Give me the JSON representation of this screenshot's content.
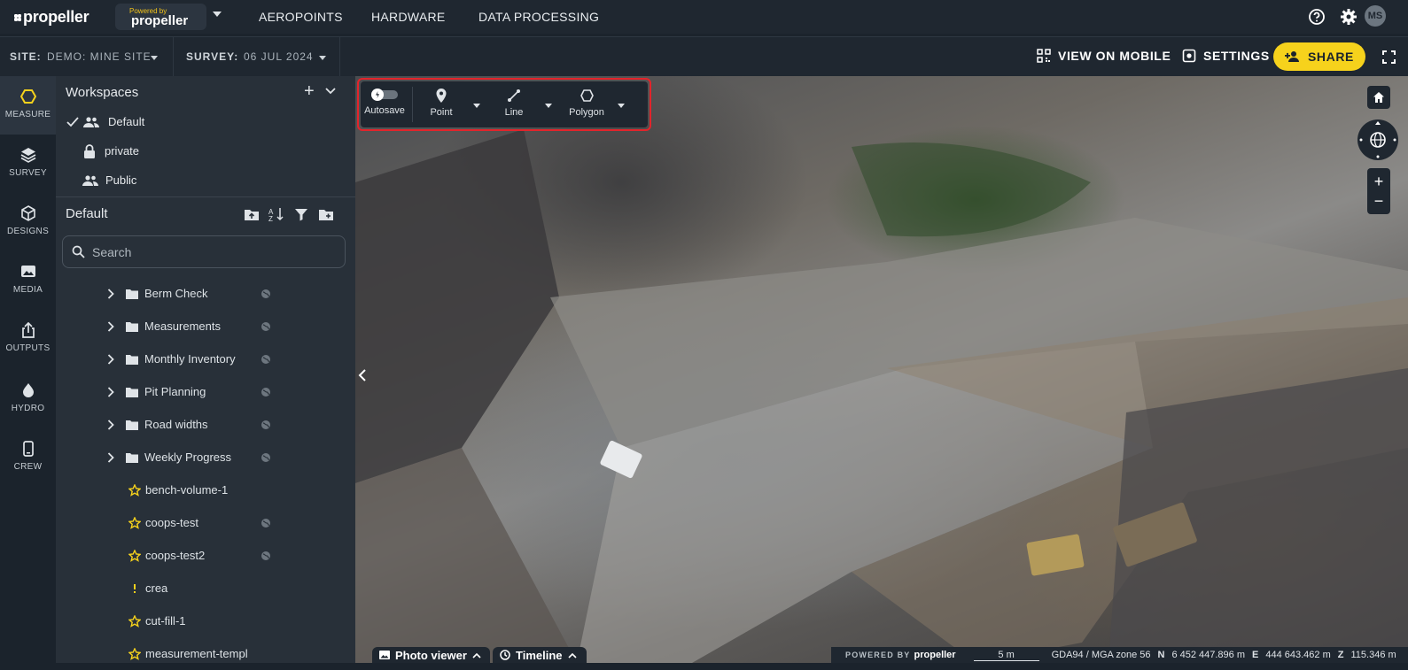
{
  "app": {
    "logo_text": "propeller",
    "powered_small": "Powered by",
    "powered_big": "propeller"
  },
  "topnav": {
    "items": [
      "AEROPOINTS",
      "HARDWARE",
      "DATA PROCESSING"
    ],
    "avatar_initials": "MS",
    "icons": [
      "help-icon",
      "gear-icon"
    ]
  },
  "subbar": {
    "site_label": "SITE:",
    "site_value": "DEMO: MINE SITE",
    "survey_label": "SURVEY:",
    "survey_value": "06 JUL 2024",
    "view_mobile": "VIEW ON MOBILE",
    "settings": "SETTINGS",
    "share": "SHARE"
  },
  "rail": {
    "items": [
      {
        "label": "MEASURE",
        "icon": "measure-icon",
        "active": true
      },
      {
        "label": "SURVEY",
        "icon": "layers-icon",
        "active": false
      },
      {
        "label": "DESIGNS",
        "icon": "cube-icon",
        "active": false
      },
      {
        "label": "MEDIA",
        "icon": "image-icon",
        "active": false
      },
      {
        "label": "OUTPUTS",
        "icon": "export-icon",
        "active": false
      },
      {
        "label": "HYDRO",
        "icon": "drop-icon",
        "active": false
      },
      {
        "label": "CREW",
        "icon": "mobile-icon",
        "active": false
      }
    ]
  },
  "panel": {
    "workspaces_title": "Workspaces",
    "workspaces": [
      {
        "label": "Default",
        "icon": "group-icon",
        "selected": true
      },
      {
        "label": "private",
        "icon": "lock-icon",
        "selected": false
      },
      {
        "label": "Public",
        "icon": "group-icon",
        "selected": false
      }
    ],
    "default_title": "Default",
    "search_placeholder": "Search",
    "folders": [
      "Berm Check",
      "Measurements",
      "Monthly Inventory",
      "Pit Planning",
      "Road widths",
      "Weekly Progress"
    ],
    "items": [
      "bench-volume-1",
      "coops-test",
      "coops-test2",
      "crea",
      "cut-fill-1",
      "measurement-templ"
    ]
  },
  "toolbar": {
    "autosave": "Autosave",
    "point": "Point",
    "line": "Line",
    "polygon": "Polygon"
  },
  "bottom": {
    "photo_viewer": "Photo viewer",
    "timeline": "Timeline",
    "powered_by": "POWERED BY",
    "powered_logo": "propeller",
    "scale": "5 m",
    "crs": "GDA94 / MGA zone 56",
    "n_label": "N",
    "n_value": "6 452 447.896 m",
    "e_label": "E",
    "e_value": "444 643.462 m",
    "z_label": "Z",
    "z_value": "115.346 m"
  },
  "colors": {
    "accent": "#f6d21c",
    "highlight": "#e3242b",
    "bg": "#1b232c",
    "panel": "#283039"
  }
}
